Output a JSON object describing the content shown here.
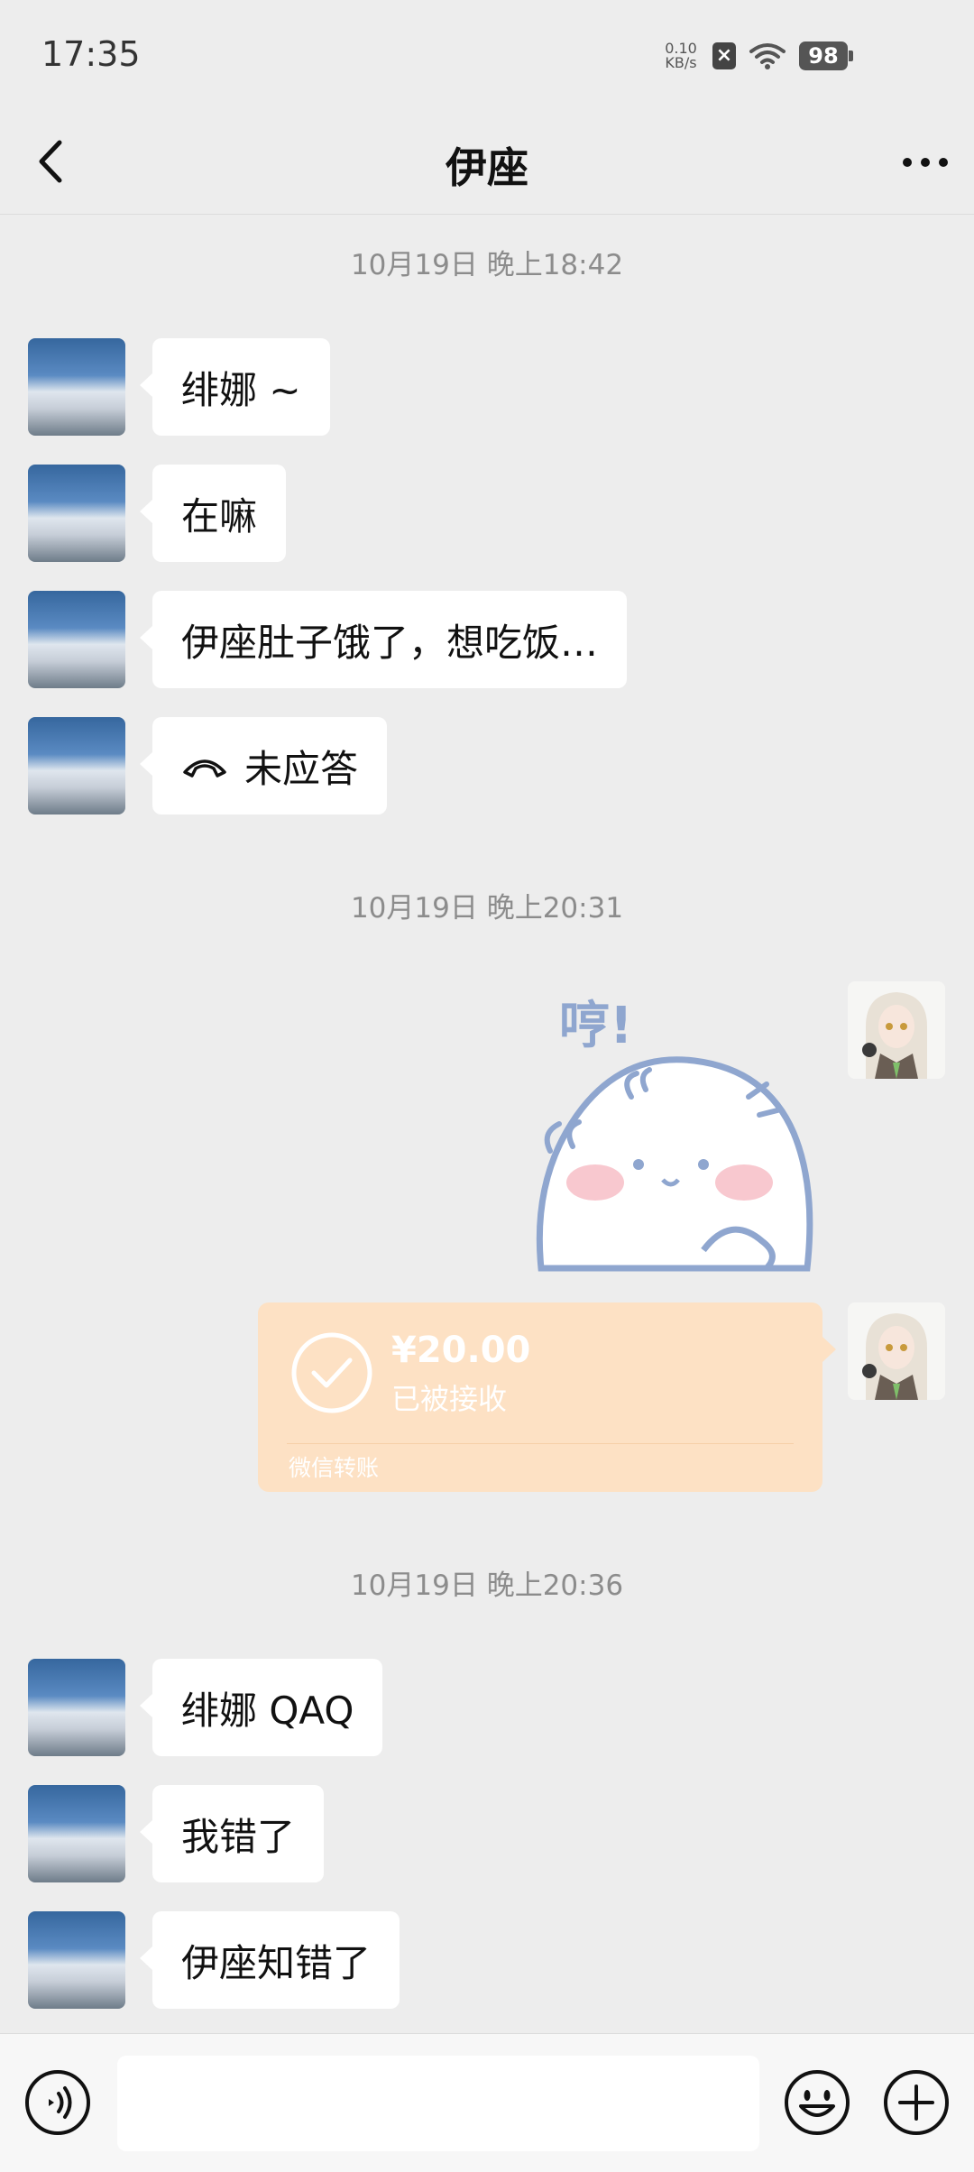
{
  "status_bar": {
    "time": "17:35",
    "net_speed_value": "0.10",
    "net_speed_unit": "KB/s",
    "battery": "98"
  },
  "header": {
    "title": "伊座"
  },
  "messages": {
    "timestamp_1": "10月19日 晚上18:42",
    "msg_1": "绯娜 ~",
    "msg_2": "在嘛",
    "msg_3": "伊座肚子饿了，想吃饭…",
    "call_status": "未应答",
    "timestamp_2": "10月19日 晚上20:31",
    "sticker_text": "哼!",
    "transfer": {
      "amount": "¥20.00",
      "status": "已被接收",
      "label": "微信转账"
    },
    "timestamp_3": "10月19日 晚上20:36",
    "msg_4": "绯娜 QAQ",
    "msg_5": "我错了",
    "msg_6": "伊座知错了"
  },
  "input": {
    "value": ""
  },
  "colors": {
    "background": "#ededed",
    "bubble_incoming": "#ffffff",
    "transfer_bg": "#fde1c4",
    "timestamp_text": "#8c8c8c"
  },
  "icons": [
    "back-arrow-icon",
    "more-icon",
    "hangup-phone-icon",
    "check-circle-icon",
    "voice-icon",
    "emoji-icon",
    "plus-icon"
  ]
}
